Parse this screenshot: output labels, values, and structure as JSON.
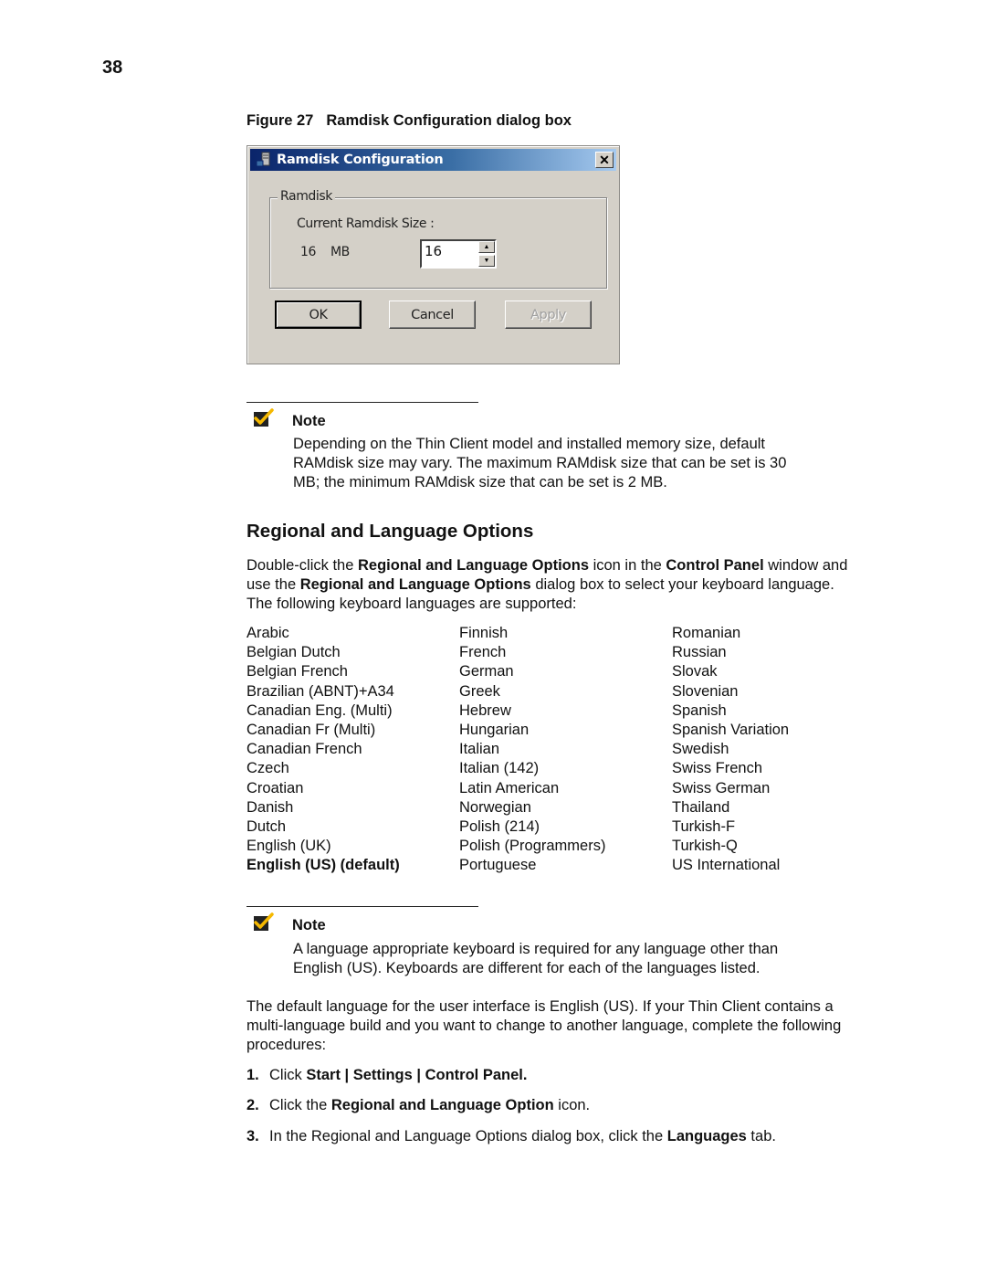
{
  "page_number": "38",
  "figure": {
    "number": "Figure 27",
    "title": "Ramdisk Configuration dialog box"
  },
  "dialog": {
    "title": "Ramdisk Configuration",
    "close_icon": "close-x-icon",
    "app_icon": "ramdisk-app-icon",
    "group_label": "Ramdisk",
    "current_size_label": "Current Ramdisk Size :",
    "current_size_value": "16",
    "current_size_unit": "MB",
    "spinner_value": "16",
    "buttons": {
      "ok": "OK",
      "cancel": "Cancel",
      "apply": "Apply"
    }
  },
  "note1": {
    "icon": "checkmark-icon",
    "title": "Note",
    "lines": [
      "Depending on the Thin Client model and installed memory size, default",
      "RAMdisk size may vary. The maximum RAMdisk size that can be set is 30",
      "MB; the minimum RAMdisk size that can be set is 2 MB."
    ]
  },
  "section": {
    "heading": "Regional and Language Options",
    "intro": {
      "p1": "Double-click the ",
      "b1": "Regional and Language Options",
      "p2": " icon in the ",
      "b2": "Control Panel",
      "p3": " window and",
      "p4": "use the ",
      "b3": "Regional and Language Options",
      "p5": " dialog box to select your keyboard language.",
      "p6": "The following keyboard languages are supported:"
    }
  },
  "languages": {
    "col1": [
      "Arabic",
      "Belgian Dutch",
      "Belgian French",
      "Brazilian (ABNT)+A34",
      "Canadian Eng. (Multi)",
      "Canadian Fr (Multi)",
      "Canadian French",
      "Czech",
      "Croatian",
      "Danish",
      "Dutch",
      "English (UK)",
      "English (US) (default)"
    ],
    "col2": [
      "Finnish",
      "French",
      "German",
      "Greek",
      "Hebrew",
      "Hungarian",
      "Italian",
      "Italian (142)",
      "Latin American",
      "Norwegian",
      "Polish (214)",
      "Polish (Programmers)",
      "Portuguese"
    ],
    "col3": [
      "Romanian",
      "Russian",
      "Slovak",
      "Slovenian",
      "Spanish",
      "Spanish Variation",
      "Swedish",
      "Swiss French",
      "Swiss German",
      "Thailand",
      "Turkish-F",
      "Turkish-Q",
      "US International"
    ]
  },
  "note2": {
    "icon": "checkmark-icon",
    "title": "Note",
    "lines": [
      "A language appropriate keyboard is required for any language other than",
      "English (US). Keyboards are different for each of the languages listed."
    ]
  },
  "paragraph": {
    "lines": [
      "The default language for the user interface is English (US). If your Thin Client contains a",
      "multi-language build and you want to change to another language, complete the following",
      "procedures:"
    ]
  },
  "steps": [
    {
      "num": "1.",
      "pre": "Click ",
      "bold": "Start | Settings | Control Panel.",
      "post": ""
    },
    {
      "num": "2.",
      "pre": "Click the ",
      "bold": "Regional and Language Option",
      "post": " icon."
    },
    {
      "num": "3.",
      "pre": "In the Regional and Language Options dialog box, click the ",
      "bold": "Languages",
      "post": " tab."
    }
  ]
}
